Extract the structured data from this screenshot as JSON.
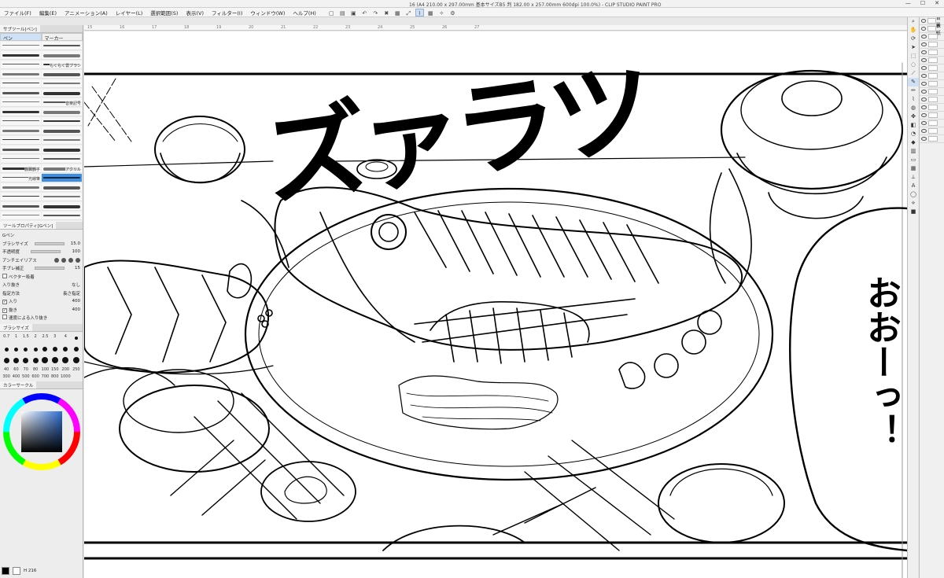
{
  "title": "16 (A4 210.00 x 297.00mm 基本サイズB5 判 182.00 x 257.00mm 600dpi 100.0%) - CLIP STUDIO PAINT PRO",
  "menu": [
    "ファイル(F)",
    "編集(E)",
    "アニメーション(A)",
    "レイヤー(L)",
    "選択範囲(S)",
    "表示(V)",
    "フィルター(I)",
    "ウィンドウ(W)",
    "ヘルプ(H)"
  ],
  "left_panel": {
    "header": "サブツール[ペン]",
    "tab_pen": "ペン",
    "tab_marker": "マーカー",
    "brushes": [
      "",
      "",
      "",
      "",
      "",
      "もくもく雲ブラシ",
      "",
      "",
      "",
      "",
      "",
      "",
      "",
      "音楽記号",
      "",
      "",
      "",
      "",
      "",
      "",
      "",
      "",
      "",
      "",
      "",
      "",
      "鶴翼鶴子",
      "アクリル",
      "光線筆",
      "",
      "",
      "",
      "",
      "",
      "",
      "",
      "",
      "",
      "",
      "",
      "",
      "",
      "",
      ""
    ],
    "tool_property_header": "ツールプロパティ[Gペン]",
    "tool_name": "Gペン",
    "props": {
      "brush_size_label": "ブラシサイズ",
      "brush_size_value": "15.0",
      "opacity_label": "不透明度",
      "opacity_value": "100",
      "antialias_label": "アンチエイリアス",
      "stabilize_label": "手ブレ補正",
      "stabilize_value": "15",
      "vector_label": "ベクター吸着",
      "in_out_label": "入り抜き",
      "in_out_value": "なし",
      "method_label": "指定方法",
      "method_value": "長さ指定",
      "in_label": "入り",
      "in_value": "400",
      "out_label": "抜き",
      "out_value": "400",
      "speed_label": "速度による入り抜き"
    },
    "size_header": "ブラシサイズ",
    "sizes": [
      "0.7",
      "1",
      "1.5",
      "2",
      "2.5",
      "3",
      "4",
      "",
      "",
      "",
      "",
      "",
      "",
      "",
      "",
      "",
      "",
      "",
      "",
      "",
      "",
      "",
      "",
      "",
      "40",
      "60",
      "70",
      "80",
      "100",
      "150",
      "200",
      "250",
      "300",
      "400",
      "500",
      "600",
      "700",
      "800",
      "1000"
    ],
    "color_header": "カラーサークル",
    "color_value": "H 216",
    "main_color": "#000000",
    "sub_color": "#ffffff"
  },
  "ruler": [
    "15",
    "16",
    "17",
    "18",
    "19",
    "20",
    "21",
    "22",
    "23",
    "24",
    "25",
    "26",
    "27"
  ],
  "canvas": {
    "sfx_main": "ズァラツ",
    "sfx_side": "おおーっ！"
  },
  "right_panel": {
    "layers": [
      "背景",
      "表紙",
      "",
      "",
      "",
      "",
      "",
      "",
      "",
      "",
      "",
      "",
      "",
      "",
      "",
      ""
    ]
  }
}
